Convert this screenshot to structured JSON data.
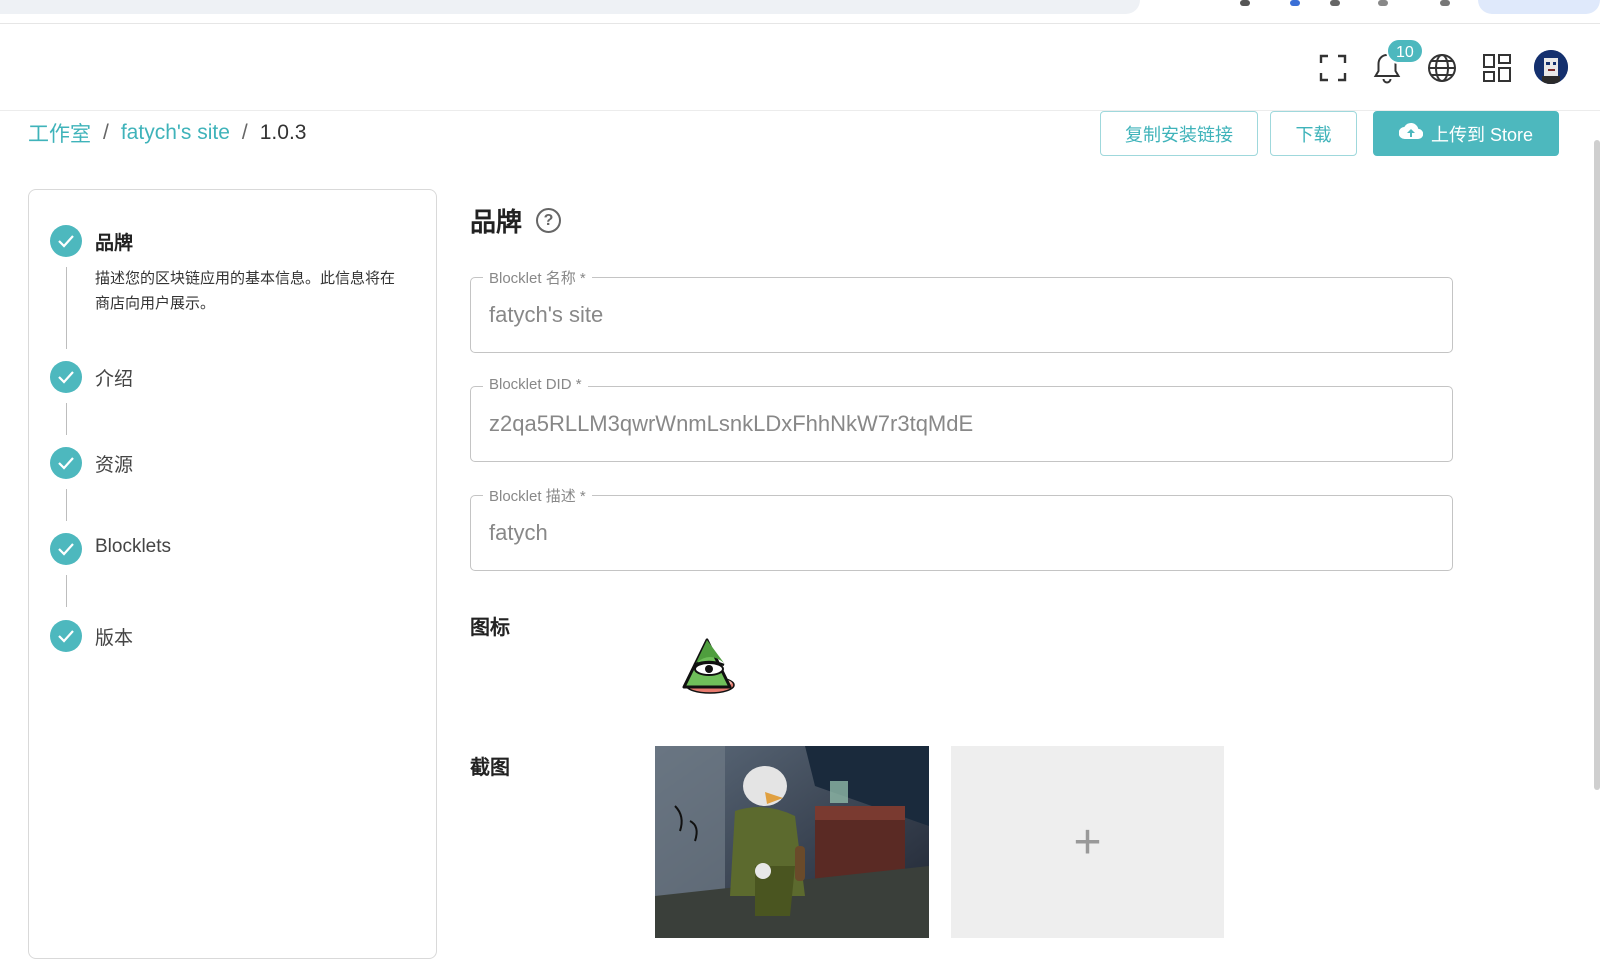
{
  "topbar": {
    "notification_count": "10",
    "icons": [
      "fullscreen-icon",
      "bell-icon",
      "globe-icon",
      "apps-grid-icon",
      "avatar"
    ]
  },
  "breadcrumb": {
    "items": [
      "工作室",
      "fatych's site"
    ],
    "separator": "/",
    "current": "1.0.3"
  },
  "actions": {
    "copy_link": "复制安装链接",
    "download": "下载",
    "upload": "上传到 Store"
  },
  "steps": [
    {
      "label": "品牌",
      "description": "描述您的区块链应用的基本信息。此信息将在商店向用户展示。"
    },
    {
      "label": "介绍"
    },
    {
      "label": "资源"
    },
    {
      "label": "Blocklets"
    },
    {
      "label": "版本"
    }
  ],
  "section": {
    "title": "品牌",
    "help": "?"
  },
  "fields": {
    "name": {
      "label": "Blocklet 名称 *",
      "value": "fatych's site"
    },
    "did": {
      "label": "Blocklet DID *",
      "value": "z2qa5RLLM3qwrWnmLsnkLDxFhhNkW7r3tqMdE"
    },
    "description": {
      "label": "Blocklet 描述 *",
      "value": "fatych"
    }
  },
  "icon_label": "图标",
  "screenshots_label": "截图",
  "add_symbol": "+",
  "colors": {
    "accent": "#4db8be",
    "link": "#3fb3ba",
    "border": "#c4c4c4"
  }
}
